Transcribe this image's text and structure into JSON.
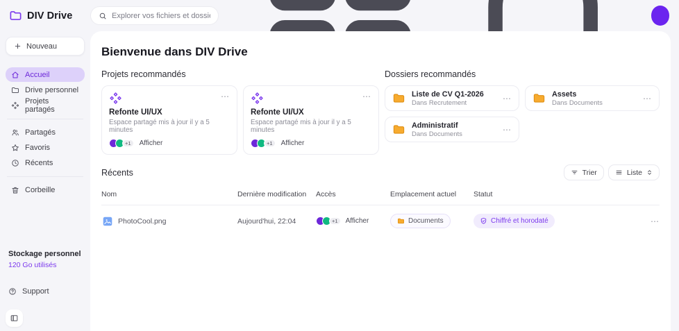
{
  "app": {
    "name": "DIV Drive"
  },
  "topbar": {
    "search_placeholder": "Explorer vos fichiers et dossiers"
  },
  "icons": {
    "more": "⋯"
  },
  "sidebar": {
    "new_label": "Nouveau",
    "nav_primary": [
      {
        "label": "Accueil"
      },
      {
        "label": "Drive personnel"
      },
      {
        "label": "Projets partagés"
      }
    ],
    "nav_secondary": [
      {
        "label": "Partagés"
      },
      {
        "label": "Favoris"
      },
      {
        "label": "Récents"
      }
    ],
    "trash_label": "Corbeille",
    "storage_title": "Stockage personnel",
    "storage_usage": "120 Go utilisés",
    "support_label": "Support"
  },
  "main": {
    "title": "Bienvenue dans DIV Drive",
    "projects": {
      "heading": "Projets recommandés",
      "cards": [
        {
          "title": "Refonte UI/UX",
          "subtitle": "Espace partagé mis à jour il y a 5 minutes",
          "extra_count": "+1",
          "action": "Afficher"
        },
        {
          "title": "Refonte UI/UX",
          "subtitle": "Espace partagé mis à jour il y a 5 minutes",
          "extra_count": "+1",
          "action": "Afficher"
        }
      ]
    },
    "folders": {
      "heading": "Dossiers recommandés",
      "cards": [
        {
          "title": "Liste de CV Q1-2026",
          "subtitle": "Dans Recrutement"
        },
        {
          "title": "Assets",
          "subtitle": "Dans Documents"
        },
        {
          "title": "Administratif",
          "subtitle": "Dans Documents"
        }
      ]
    },
    "recents": {
      "heading": "Récents",
      "sort_label": "Trier",
      "view_label": "Liste",
      "columns": [
        "Nom",
        "Dernière modification",
        "Accès",
        "Emplacement actuel",
        "Statut"
      ],
      "rows": [
        {
          "name": "PhotoCool.png",
          "modified": "Aujourd'hui, 22:04",
          "extra_count": "+1",
          "access_action": "Afficher",
          "location": "Documents",
          "status": "Chiffré et horodaté"
        }
      ]
    }
  },
  "colors": {
    "accent": "#6d28d9",
    "accent_light": "#ddd1fa",
    "avatar_purple": "#6d28d9",
    "avatar_green": "#10b981",
    "folder_amber": "#f5a623",
    "page_bg": "#f5f5f9"
  }
}
